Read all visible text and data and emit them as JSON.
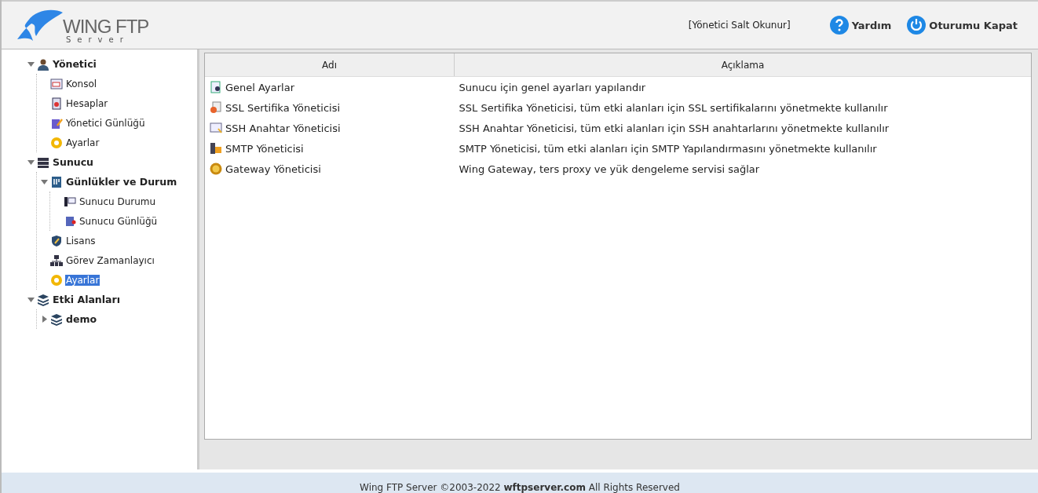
{
  "header": {
    "logo": {
      "title": "WING FTP",
      "subtitle": "Server"
    },
    "role": "[Yönetici Salt Okunur]",
    "help": "Yardım",
    "logout": "Oturumu Kapat"
  },
  "tree": [
    {
      "label": "Yönetici",
      "kind": "admin",
      "expanded": true,
      "selected": false,
      "children": [
        {
          "label": "Konsol",
          "kind": "console",
          "selected": false
        },
        {
          "label": "Hesaplar",
          "kind": "accounts",
          "selected": false
        },
        {
          "label": "Yönetici Günlüğü",
          "kind": "log",
          "selected": false
        },
        {
          "label": "Ayarlar",
          "kind": "settings",
          "selected": false
        }
      ]
    },
    {
      "label": "Sunucu",
      "kind": "server",
      "expanded": true,
      "selected": false,
      "children": [
        {
          "label": "Günlükler ve Durum",
          "kind": "logs",
          "expanded": true,
          "selected": false,
          "children": [
            {
              "label": "Sunucu Durumu",
              "kind": "status",
              "selected": false
            },
            {
              "label": "Sunucu Günlüğü",
              "kind": "serverlog",
              "selected": false
            }
          ]
        },
        {
          "label": "Lisans",
          "kind": "license",
          "selected": false
        },
        {
          "label": "Görev Zamanlayıcı",
          "kind": "scheduler",
          "selected": false
        },
        {
          "label": "Ayarlar",
          "kind": "settings",
          "selected": true
        }
      ]
    },
    {
      "label": "Etki Alanları",
      "kind": "domains",
      "expanded": true,
      "selected": false,
      "children": [
        {
          "label": "demo",
          "kind": "domain",
          "expanded": false,
          "selected": false
        }
      ]
    }
  ],
  "table": {
    "columns": [
      "Adı",
      "Açıklama"
    ],
    "rows": [
      {
        "kind": "general",
        "name": "Genel Ayarlar",
        "description": "Sunucu için genel ayarları yapılandır"
      },
      {
        "kind": "ssl",
        "name": "SSL Sertifika Yöneticisi",
        "description": "SSL Sertifika Yöneticisi, tüm etki alanları için SSL sertifikalarını yönetmekte kullanılır"
      },
      {
        "kind": "ssh",
        "name": "SSH Anahtar Yöneticisi",
        "description": "SSH Anahtar Yöneticisi, tüm etki alanları için SSH anahtarlarını yönetmekte kullanılır"
      },
      {
        "kind": "smtp",
        "name": "SMTP Yöneticisi",
        "description": "SMTP Yöneticisi, tüm etki alanları için SMTP Yapılandırmasını yönetmekte kullanılır"
      },
      {
        "kind": "gateway",
        "name": "Gateway Yöneticisi",
        "description": "Wing Gateway, ters proxy ve yük dengeleme servisi sağlar"
      }
    ]
  },
  "footer": "Wing FTP Server ©2003-2022 **wftpserver.com** All Rights Reserved"
}
